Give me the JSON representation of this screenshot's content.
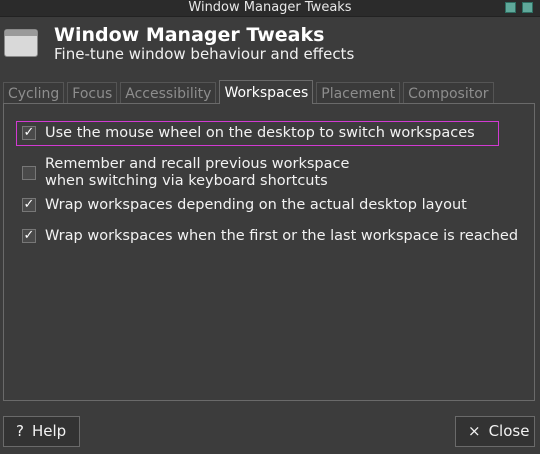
{
  "window": {
    "title": "Window Manager Tweaks"
  },
  "header": {
    "title": "Window Manager Tweaks",
    "subtitle": "Fine-tune window behaviour and effects"
  },
  "tabs": [
    {
      "label": "Cycling",
      "active": false
    },
    {
      "label": "Focus",
      "active": false
    },
    {
      "label": "Accessibility",
      "active": false
    },
    {
      "label": "Workspaces",
      "active": true
    },
    {
      "label": "Placement",
      "active": false
    },
    {
      "label": "Compositor",
      "active": false
    }
  ],
  "options": [
    {
      "line1": "Use the mouse wheel on the desktop to switch workspaces",
      "line2": "",
      "checked": true,
      "mark": "✓"
    },
    {
      "line1": "Remember and recall previous workspace",
      "line2": "when switching via keyboard shortcuts",
      "checked": false,
      "mark": ""
    },
    {
      "line1": "Wrap workspaces depending on the actual desktop layout",
      "line2": "",
      "checked": true,
      "mark": "✓"
    },
    {
      "line1": "Wrap workspaces when the first or the last workspace is reached",
      "line2": "",
      "checked": true,
      "mark": "✓"
    }
  ],
  "buttons": {
    "help_icon": "?",
    "help_label": "Help",
    "close_icon": "×",
    "close_label": "Close"
  },
  "colors": {
    "highlight": "#d23ad2",
    "background": "#3c3c3c"
  }
}
